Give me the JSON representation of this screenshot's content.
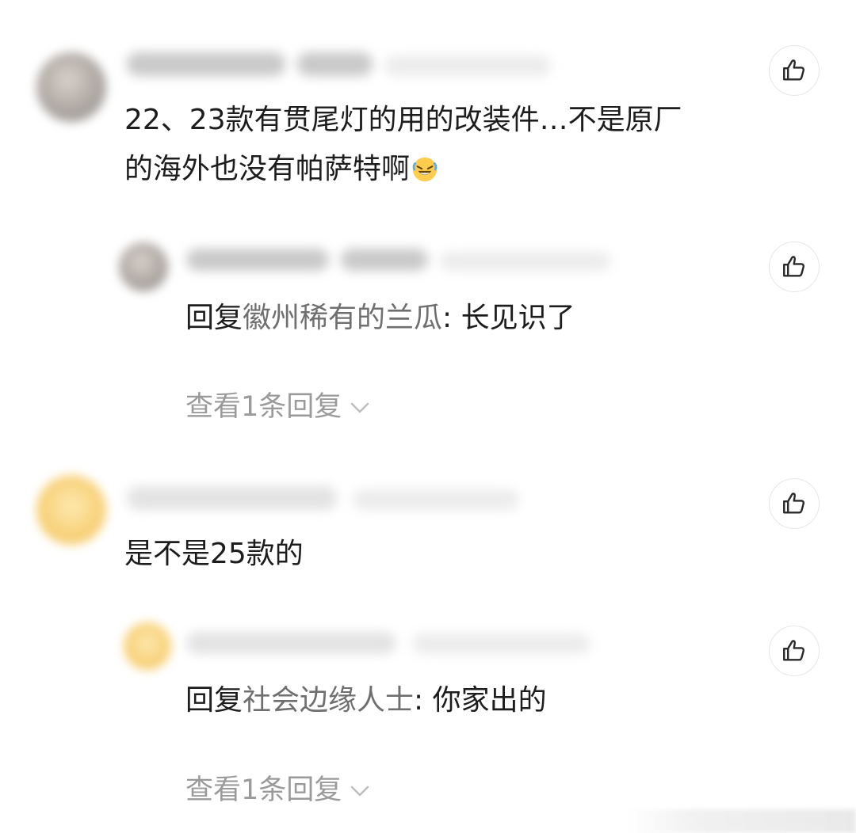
{
  "comments": [
    {
      "text": "22、23款有贯尾灯的用的改装件…不是原厂",
      "text_line2": "的海外也没有帕萨特啊",
      "emoji": "rolling-on-floor-laughing-emoji",
      "reply": {
        "prefix": "回复",
        "target": "徽州稀有的兰瓜",
        "body": ": 长见识了"
      },
      "expand_label": "查看1条回复"
    },
    {
      "text": "是不是25款的",
      "reply": {
        "prefix": "回复",
        "target": "社会边缘人士",
        "body": ": 你家出的"
      },
      "expand_label": "查看1条回复"
    }
  ],
  "icons": {
    "like": "thumbs-up-icon",
    "expand": "chevron-down-icon"
  },
  "colors": {
    "text": "#1d1d1d",
    "nickname": "#6f6f6f",
    "muted": "#9a9a9a",
    "like_border": "#e6e6e6"
  }
}
